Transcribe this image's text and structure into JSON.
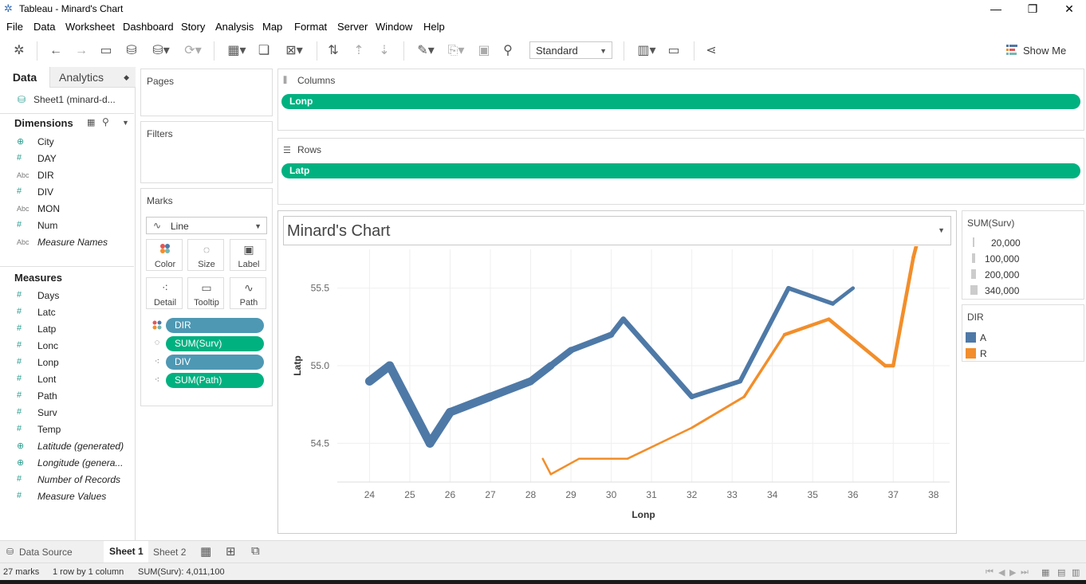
{
  "window": {
    "title": "Tableau - Minard's Chart"
  },
  "menu": [
    "File",
    "Data",
    "Worksheet",
    "Dashboard",
    "Story",
    "Analysis",
    "Map",
    "Format",
    "Server",
    "Window",
    "Help"
  ],
  "toolbar": {
    "fit_value": "Standard",
    "show_me": "Show Me"
  },
  "data_pane": {
    "tabs": {
      "data": "Data",
      "analytics": "Analytics"
    },
    "datasource": "Sheet1 (minard-d...",
    "dimensions_header": "Dimensions",
    "dimensions": [
      {
        "icon": "globe-icon",
        "name": "City"
      },
      {
        "icon": "hash-icon",
        "name": "DAY"
      },
      {
        "icon": "abc-icon",
        "name": "DIR"
      },
      {
        "icon": "hash-icon",
        "name": "DIV"
      },
      {
        "icon": "abc-icon",
        "name": "MON"
      },
      {
        "icon": "hash-icon",
        "name": "Num"
      },
      {
        "icon": "abc-icon",
        "name": "Measure Names"
      }
    ],
    "measures_header": "Measures",
    "measures": [
      {
        "icon": "hash-icon",
        "name": "Days"
      },
      {
        "icon": "hash-icon",
        "name": "Latc"
      },
      {
        "icon": "hash-icon",
        "name": "Latp"
      },
      {
        "icon": "hash-icon",
        "name": "Lonc"
      },
      {
        "icon": "hash-icon",
        "name": "Lonp"
      },
      {
        "icon": "hash-icon",
        "name": "Lont"
      },
      {
        "icon": "hash-icon",
        "name": "Path"
      },
      {
        "icon": "hash-icon",
        "name": "Surv"
      },
      {
        "icon": "hash-icon",
        "name": "Temp"
      },
      {
        "icon": "globe-icon",
        "name": "Latitude (generated)"
      },
      {
        "icon": "globe-icon",
        "name": "Longitude (genera..."
      },
      {
        "icon": "hash-icon",
        "name": "Number of Records"
      },
      {
        "icon": "hash-icon",
        "name": "Measure Values"
      }
    ]
  },
  "cards": {
    "pages": "Pages",
    "filters": "Filters",
    "marks": "Marks",
    "mark_type": "Line",
    "mark_buttons": [
      "Color",
      "Size",
      "Label",
      "Detail",
      "Tooltip",
      "Path"
    ],
    "mark_pills": [
      "DIR",
      "SUM(Surv)",
      "DIV",
      "SUM(Path)"
    ]
  },
  "shelves": {
    "columns_label": "Columns",
    "columns_pill": "Lonp",
    "rows_label": "Rows",
    "rows_pill": "Latp"
  },
  "view": {
    "title": "Minard's Chart"
  },
  "legends": {
    "size_title": "SUM(Surv)",
    "size_items": [
      "20,000",
      "100,000",
      "200,000",
      "340,000"
    ],
    "color_title": "DIR",
    "color_items": [
      {
        "label": "A",
        "color": "#4e79a7"
      },
      {
        "label": "R",
        "color": "#f28e2b"
      }
    ]
  },
  "bottom": {
    "data_source": "Data Source",
    "sheets": [
      "Sheet 1",
      "Sheet 2"
    ]
  },
  "status": {
    "marks": "27 marks",
    "dims": "1 row by 1 column",
    "sum": "SUM(Surv): 4,011,100"
  },
  "chart_data": {
    "type": "line",
    "xlabel": "Lonp",
    "ylabel": "Latp",
    "xlim": [
      23.2,
      38.4
    ],
    "ylim": [
      54.25,
      55.75
    ],
    "x_ticks": [
      24,
      25,
      26,
      27,
      28,
      29,
      30,
      31,
      32,
      33,
      34,
      35,
      36,
      37,
      38
    ],
    "y_ticks": [
      54.5,
      55.0,
      55.5
    ],
    "grid": true,
    "series": [
      {
        "name": "A",
        "color": "#4e79a7",
        "points": [
          {
            "x": 24.0,
            "y": 54.9,
            "surv": 340000
          },
          {
            "x": 24.5,
            "y": 55.0,
            "surv": 340000
          },
          {
            "x": 25.5,
            "y": 54.5,
            "surv": 340000
          },
          {
            "x": 26.0,
            "y": 54.7,
            "surv": 320000
          },
          {
            "x": 27.0,
            "y": 54.8,
            "surv": 300000
          },
          {
            "x": 28.0,
            "y": 54.9,
            "surv": 280000
          },
          {
            "x": 28.5,
            "y": 55.0,
            "surv": 240000
          },
          {
            "x": 29.0,
            "y": 55.1,
            "surv": 210000
          },
          {
            "x": 30.0,
            "y": 55.2,
            "surv": 180000
          },
          {
            "x": 30.3,
            "y": 55.3,
            "surv": 175000
          },
          {
            "x": 32.0,
            "y": 54.8,
            "surv": 145000
          },
          {
            "x": 33.2,
            "y": 54.9,
            "surv": 140000
          },
          {
            "x": 34.4,
            "y": 55.5,
            "surv": 127100
          },
          {
            "x": 35.5,
            "y": 55.4,
            "surv": 100000
          },
          {
            "x": 36.0,
            "y": 55.5,
            "surv": 100000
          }
        ]
      },
      {
        "name": "R",
        "color": "#f28e2b",
        "points": [
          {
            "x": 37.6,
            "y": 55.8,
            "surv": 100000
          },
          {
            "x": 37.5,
            "y": 55.7,
            "surv": 98000
          },
          {
            "x": 37.0,
            "y": 55.0,
            "surv": 97000
          },
          {
            "x": 36.8,
            "y": 55.0,
            "surv": 96000
          },
          {
            "x": 35.4,
            "y": 55.3,
            "surv": 87000
          },
          {
            "x": 34.3,
            "y": 55.2,
            "surv": 55000
          },
          {
            "x": 33.3,
            "y": 54.8,
            "surv": 37000
          },
          {
            "x": 32.0,
            "y": 54.6,
            "surv": 24000
          },
          {
            "x": 30.4,
            "y": 54.4,
            "surv": 20000
          },
          {
            "x": 29.2,
            "y": 54.4,
            "surv": 20000
          },
          {
            "x": 28.5,
            "y": 54.3,
            "surv": 20000
          },
          {
            "x": 28.3,
            "y": 54.4,
            "surv": 20000
          }
        ]
      }
    ]
  }
}
